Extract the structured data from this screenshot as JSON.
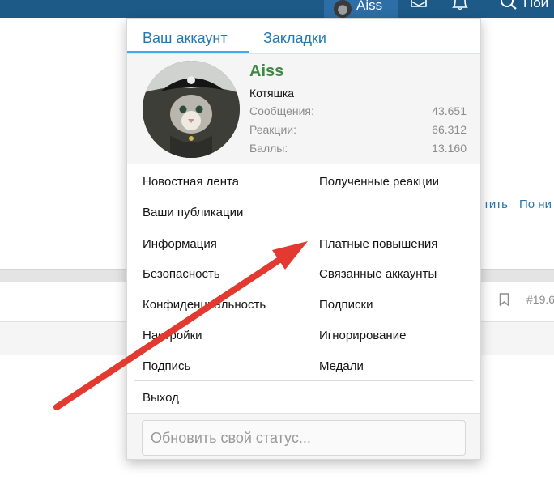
{
  "colors": {
    "topbar": "#1d5a88",
    "nav_active": "#2c6ea5",
    "link": "#2577b1",
    "tab_underline": "#47a7eb",
    "username": "#3e8a45",
    "arrow": "#e23a30"
  },
  "navbar": {
    "user_name": "Aiss",
    "search_label": "Пои",
    "icons": [
      "envelope-icon",
      "bell-icon",
      "search-icon"
    ]
  },
  "background": {
    "link_1": "тить",
    "link_2": "По ни",
    "post_number": "#19.6"
  },
  "menu": {
    "tabs": [
      {
        "label": "Ваш аккаунт",
        "active": true
      },
      {
        "label": "Закладки",
        "active": false
      }
    ],
    "profile": {
      "name": "Aiss",
      "user_title": "Котяшка",
      "stats": [
        {
          "label": "Сообщения:",
          "value": "43.651"
        },
        {
          "label": "Реакции:",
          "value": "66.312"
        },
        {
          "label": "Баллы:",
          "value": "13.160"
        }
      ]
    },
    "links": {
      "news_feed": "Новостная лента",
      "received_reactions": "Полученные реакции",
      "your_posts": "Ваши публикации",
      "info": "Информация",
      "paid_upgrades": "Платные повышения",
      "security": "Безопасность",
      "connected_accounts": "Связанные аккаунты",
      "privacy": "Конфиденциальность",
      "following": "Подписки",
      "settings": "Настройки",
      "ignoring": "Игнорирование",
      "signature": "Подпись",
      "medals": "Медали",
      "logout": "Выход"
    },
    "status": {
      "placeholder": "Обновить свой статус..."
    }
  }
}
